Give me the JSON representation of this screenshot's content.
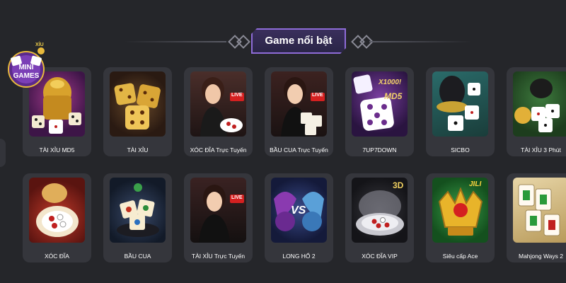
{
  "header": {
    "title": "Game nổi bật"
  },
  "badge": {
    "line1": "MINI",
    "line2": "GAMES",
    "tag": "XỈU"
  },
  "live_tag": "LIVE",
  "jili_text": "JILI",
  "md5_text": "MD5",
  "x1000_text": "X1000!",
  "threed_text": "3D",
  "vs_text": "VS",
  "row1": [
    {
      "label": "TÀI XỈU MD5"
    },
    {
      "label": "TÀI XỈU"
    },
    {
      "label": "XÓC ĐĨA Trực Tuyến"
    },
    {
      "label": "BẦU CUA Trực Tuyến"
    },
    {
      "label": "7UP7DOWN"
    },
    {
      "label": "SICBO"
    },
    {
      "label": "TÀI XỈU 3 Phút"
    }
  ],
  "row2": [
    {
      "label": "XÓC ĐĨA"
    },
    {
      "label": "BẦU CUA"
    },
    {
      "label": "TÀI XỈU Trực Tuyến"
    },
    {
      "label": "LONG HỔ 2"
    },
    {
      "label": "XÓC ĐĨA VIP"
    },
    {
      "label": "Siêu cấp Ace"
    },
    {
      "label": "Mahjong Ways 2"
    }
  ]
}
